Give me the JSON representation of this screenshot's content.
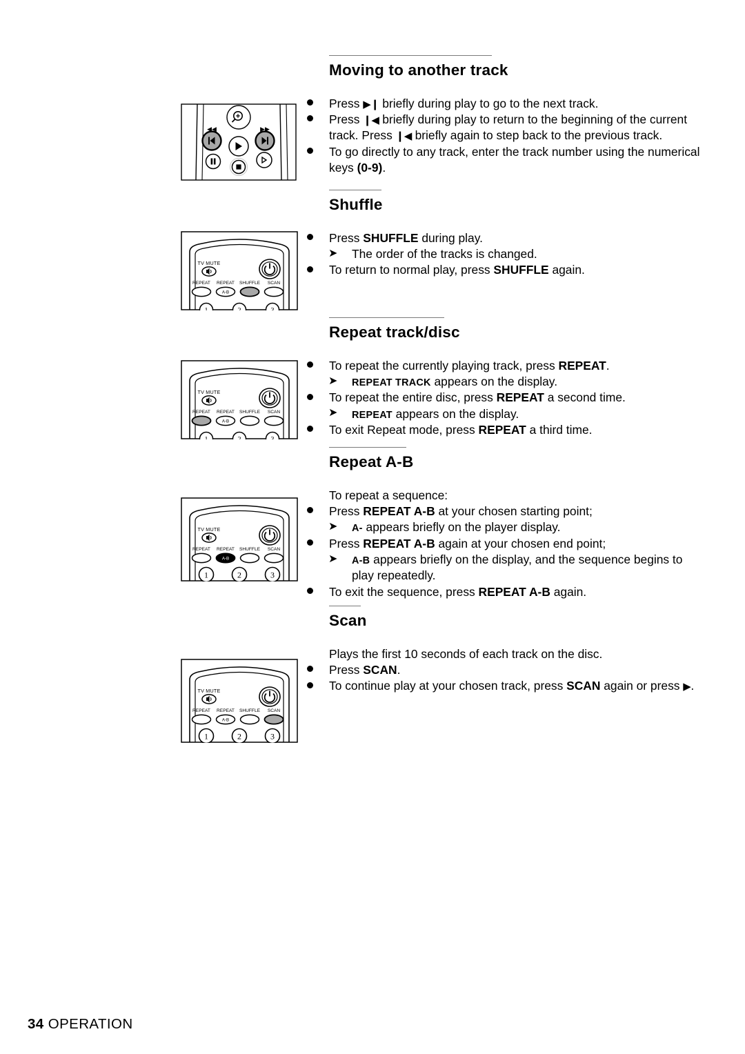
{
  "document": {
    "footer": {
      "page_number": "34",
      "section_name": "OPERATION"
    }
  },
  "sections": [
    {
      "id": "moving-to-another-track",
      "heading": "Moving to another track",
      "illustration": "remote-transport-keys",
      "illustration_highlight": [
        "prev-track-button",
        "next-track-button"
      ],
      "lines": [
        {
          "type": "bullet",
          "text_html": "Press <span class=\"glyph\">▶❙</span> briefly during play to go to the next track."
        },
        {
          "type": "bullet",
          "text_html": "Press <span class=\"glyph\">❙◀</span> briefly during play to return to the beginning of the current track. Press <span class=\"glyph\">❙◀</span> briefly again to step back to the previous track."
        },
        {
          "type": "bullet",
          "text_html": "To go directly to any track, enter the track number using the numerical keys <b>(0-9)</b>."
        }
      ]
    },
    {
      "id": "shuffle",
      "heading": "Shuffle",
      "illustration": "remote-function-keys",
      "illustration_highlight": [
        "shuffle-button"
      ],
      "lines": [
        {
          "type": "bullet",
          "text_html": "Press <b>SHUFFLE</b> during play."
        },
        {
          "type": "arrow",
          "text_html": "The order of the tracks is changed."
        },
        {
          "type": "bullet",
          "text_html": "To return to normal play, press <b>SHUFFLE</b> again."
        }
      ]
    },
    {
      "id": "repeat-track-disc",
      "heading": "Repeat track/disc",
      "illustration": "remote-function-keys",
      "illustration_highlight": [
        "repeat-button"
      ],
      "lines": [
        {
          "type": "bullet",
          "text_html": "To repeat the currently playing track, press <b>REPEAT</b>."
        },
        {
          "type": "arrow",
          "text_html": "<span class=\"smallcaps\">REPEAT TRACK</span> appears on the display."
        },
        {
          "type": "bullet",
          "text_html": "To repeat the entire disc, press <b>REPEAT</b> a second time."
        },
        {
          "type": "arrow",
          "text_html": "<span class=\"smallcaps\">REPEAT</span> appears on the display."
        },
        {
          "type": "bullet",
          "text_html": "To exit Repeat mode, press <b>REPEAT</b> a third time."
        }
      ]
    },
    {
      "id": "repeat-a-b",
      "heading": "Repeat A-B",
      "illustration": "remote-function-keys",
      "illustration_highlight": [
        "repeat-a-b-button"
      ],
      "lines": [
        {
          "type": "plain",
          "text_html": "To repeat a sequence:"
        },
        {
          "type": "bullet",
          "text_html": "Press <b>REPEAT A-B</b> at your chosen starting point;"
        },
        {
          "type": "arrow",
          "text_html": "<span class=\"smallcaps\">A-</span> appears briefly on the player display."
        },
        {
          "type": "bullet",
          "text_html": "Press <b>REPEAT A-B</b> again at your chosen end point;"
        },
        {
          "type": "arrow",
          "text_html": "<span class=\"smallcaps\">A-B</span> appears briefly on the display, and the sequence begins to play repeatedly."
        },
        {
          "type": "bullet",
          "text_html": "To exit the sequence, press <b>REPEAT A-B</b> again."
        }
      ]
    },
    {
      "id": "scan",
      "heading": "Scan",
      "illustration": "remote-function-keys",
      "illustration_highlight": [
        "scan-button"
      ],
      "lines": [
        {
          "type": "plain",
          "text_html": "Plays the first 10 seconds of each track on the disc."
        },
        {
          "type": "bullet",
          "text_html": "Press <b>SCAN</b>."
        },
        {
          "type": "bullet",
          "text_html": "To continue play at your chosen track, press <b>SCAN</b> again or press <span class=\"glyph\">▶</span>."
        }
      ]
    }
  ],
  "remote_function_keys": {
    "tv_mute_label": "TV MUTE",
    "power_label": "power-icon",
    "buttons": [
      "REPEAT",
      "REPEAT",
      "SHUFFLE",
      "SCAN"
    ],
    "repeat_ab_inner_label": "A-B",
    "number_keys": [
      "1",
      "2",
      "3"
    ]
  },
  "remote_transport_keys": {
    "zoom_label": "zoom-icon",
    "rewind_label": "◀◀",
    "forward_label": "▶▶",
    "buttons": [
      "prev-track",
      "play",
      "next-track",
      "pause",
      "stop",
      "slow-step"
    ]
  },
  "colors": {
    "text": "#000000",
    "rule": "#7a7a7a",
    "highlight_fill": "#a8a8a8",
    "highlight_dark": "#000000",
    "page_bg": "#ffffff"
  }
}
